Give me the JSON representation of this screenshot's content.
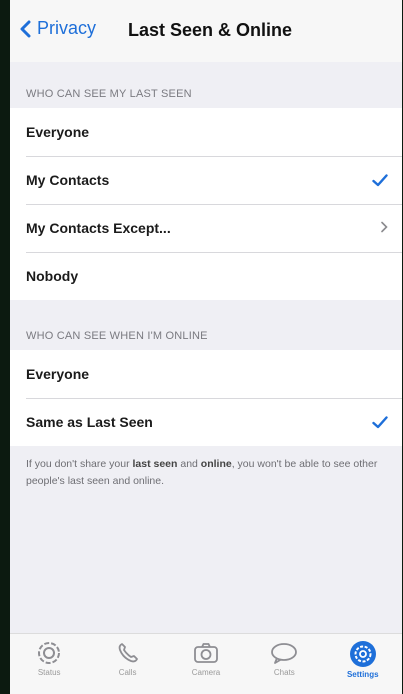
{
  "nav": {
    "back_label": "Privacy",
    "title": "Last Seen & Online"
  },
  "last_seen": {
    "header": "WHO CAN SEE MY LAST SEEN",
    "options": [
      {
        "label": "Everyone",
        "selected": false
      },
      {
        "label": "My Contacts",
        "selected": true
      },
      {
        "label": "My Contacts Except...",
        "has_chevron": true
      },
      {
        "label": "Nobody",
        "selected": false
      }
    ]
  },
  "online": {
    "header": "WHO CAN SEE WHEN I'M ONLINE",
    "options": [
      {
        "label": "Everyone",
        "selected": false
      },
      {
        "label": "Same as Last Seen",
        "selected": true
      }
    ]
  },
  "footer_note": {
    "part1": "If you don't share your ",
    "bold1": "last seen",
    "part2": " and ",
    "bold2": "online",
    "part3": ", you won't be able to see other people's last seen and online."
  },
  "tabbar": {
    "tabs": [
      {
        "label": "Status",
        "icon": "status-icon"
      },
      {
        "label": "Calls",
        "icon": "phone-icon"
      },
      {
        "label": "Camera",
        "icon": "camera-icon"
      },
      {
        "label": "Chats",
        "icon": "chat-bubble-icon"
      },
      {
        "label": "Settings",
        "icon": "gear-icon",
        "active": true
      }
    ]
  },
  "colors": {
    "accent": "#1e6fd9",
    "background": "#efeff4"
  }
}
